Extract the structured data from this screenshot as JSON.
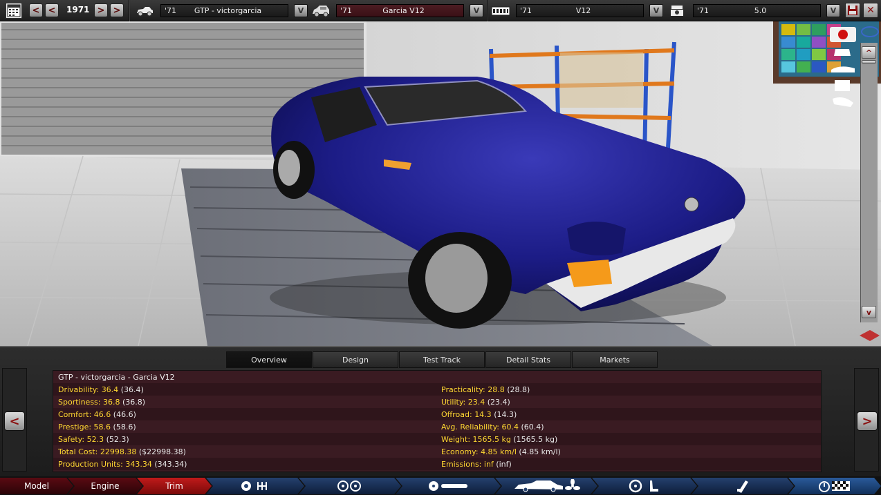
{
  "topbar": {
    "year": "1971",
    "model_select": {
      "year": "'71",
      "name": "GTP - victorgarcia"
    },
    "trim_select": {
      "year": "'71",
      "name": "Garcia V12"
    },
    "engine_family_select": {
      "year": "'71",
      "name": "V12"
    },
    "engine_variant_select": {
      "year": "'71",
      "name": "5.0"
    },
    "prev_label": "<",
    "next_label": ">",
    "dropdown_label": "V"
  },
  "viewport": {
    "rail_up_label": "^",
    "rail_down_label": "v"
  },
  "tabs": [
    "Overview",
    "Design",
    "Test Track",
    "Detail Stats",
    "Markets"
  ],
  "active_tab": "Overview",
  "panel": {
    "prev_label": "<",
    "next_label": ">",
    "title": "GTP - victorgarcia - Garcia V12",
    "left_stats": [
      {
        "label": "Drivability:",
        "value": "36.4",
        "paren": "(36.4)"
      },
      {
        "label": "Sportiness:",
        "value": "36.8",
        "paren": "(36.8)"
      },
      {
        "label": "Comfort:",
        "value": "46.6",
        "paren": "(46.6)"
      },
      {
        "label": "Prestige:",
        "value": "58.6",
        "paren": "(58.6)"
      },
      {
        "label": "Safety:",
        "value": "52.3",
        "paren": "(52.3)"
      },
      {
        "label": "Total Cost:",
        "value": "22998.38",
        "paren": "($22998.38)"
      },
      {
        "label": "Production Units:",
        "value": "343.34",
        "paren": "(343.34)"
      }
    ],
    "right_stats": [
      {
        "label": "Practicality:",
        "value": "28.8",
        "paren": "(28.8)"
      },
      {
        "label": "Utility:",
        "value": "23.4",
        "paren": "(23.4)"
      },
      {
        "label": "Offroad:",
        "value": "14.3",
        "paren": "(14.3)"
      },
      {
        "label": "Avg. Reliability:",
        "value": "60.4",
        "paren": "(60.4)"
      },
      {
        "label": "Weight:",
        "value": "1565.5 kg",
        "paren": "(1565.5 kg)"
      },
      {
        "label": "Economy:",
        "value": "4.85 km/l",
        "paren": "(4.85 km/l)"
      },
      {
        "label": "Emissions:",
        "value": "inf",
        "paren": "(inf)"
      }
    ]
  },
  "footer": {
    "model": "Model",
    "engine": "Engine",
    "trim": "Trim"
  },
  "colors": {
    "accent_red": "#8a1010",
    "stat_label": "#ffd832",
    "car_blue": "#1b1b7a"
  }
}
